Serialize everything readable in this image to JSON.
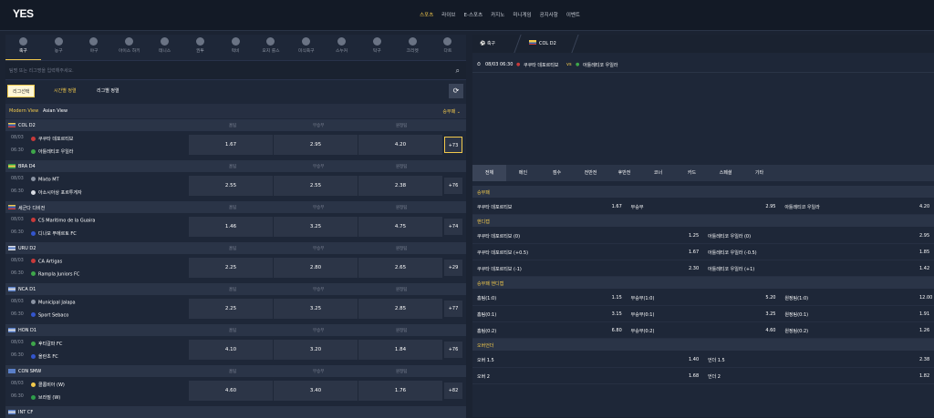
{
  "header": {
    "logo": "YES",
    "nav": [
      {
        "label": "스포츠",
        "active": true
      },
      {
        "label": "라이브"
      },
      {
        "label": "E-스포츠"
      },
      {
        "label": "카지노"
      },
      {
        "label": "미니게임"
      },
      {
        "label": "공지사항"
      },
      {
        "label": "이벤트"
      }
    ]
  },
  "sports": [
    {
      "label": "축구",
      "icon": "soccer-icon",
      "active": true
    },
    {
      "label": "농구",
      "icon": "basketball-icon"
    },
    {
      "label": "야구",
      "icon": "baseball-icon"
    },
    {
      "label": "아이스 하키",
      "icon": "hockey-icon"
    },
    {
      "label": "테니스",
      "icon": "tennis-icon"
    },
    {
      "label": "권투",
      "icon": "boxing-icon"
    },
    {
      "label": "럭비",
      "icon": "rugby-icon"
    },
    {
      "label": "오지 룰스",
      "icon": "aussie-rules-icon"
    },
    {
      "label": "미식축구",
      "icon": "american-football-icon"
    },
    {
      "label": "스누커",
      "icon": "snooker-icon"
    },
    {
      "label": "탁구",
      "icon": "table-tennis-icon"
    },
    {
      "label": "크리켓",
      "icon": "cricket-icon"
    },
    {
      "label": "다트",
      "icon": "darts-icon"
    }
  ],
  "search": {
    "placeholder": "팀명 또는 리그명을 입력해주세요."
  },
  "filters": {
    "league_select": "리그선택",
    "time_sort": "시간별 정렬",
    "league_sort": "리그별 정렬"
  },
  "views": {
    "modern": "Modern View",
    "asian": "Asian View",
    "market": "승무패"
  },
  "odds_headers": {
    "home": "홈팀",
    "draw": "무승부",
    "away": "원정팀"
  },
  "leagues": [
    {
      "name": "COL D2",
      "flag_colors": [
        "#f2c94c",
        "#2d5fb5",
        "#c83a3a"
      ],
      "match": {
        "date": "08/03",
        "time": "06:30",
        "home": "쿠쿠타 데포르티보",
        "away": "아틀레티코 우일라",
        "home_color": "#c83a3a",
        "away_color": "#3ea64a",
        "odds": [
          "1.67",
          "2.95",
          "4.20"
        ],
        "more": "+73",
        "highlight": true
      }
    },
    {
      "name": "BRA D4",
      "flag_colors": [
        "#2e9e4a",
        "#f2c94c",
        "#2e9e4a"
      ],
      "match": {
        "date": "08/03",
        "time": "06:30",
        "home": "Mixto MT",
        "away": "아소시아상 포르투게자",
        "home_color": "#8a93a3",
        "away_color": "#d8dbe2",
        "odds": [
          "2.55",
          "2.55",
          "2.38"
        ],
        "more": "+76"
      }
    },
    {
      "name": "세군다 디비전",
      "flag_colors": [
        "#f2c94c",
        "#2d5fb5",
        "#c83a3a"
      ],
      "match": {
        "date": "08/03",
        "time": "06:30",
        "home": "CS Maritimo de la Guaira",
        "away": "디나모 푸에르토 FC",
        "home_color": "#c83a3a",
        "away_color": "#3355cc",
        "odds": [
          "1.46",
          "3.25",
          "4.75"
        ],
        "more": "+74"
      }
    },
    {
      "name": "URU D2",
      "flag_colors": [
        "#d8dbe2",
        "#5a7fc8",
        "#d8dbe2"
      ],
      "match": {
        "date": "08/03",
        "time": "06:30",
        "home": "CA Artigas",
        "away": "Rampla Juniors FC",
        "home_color": "#c83a3a",
        "away_color": "#3ea64a",
        "odds": [
          "2.25",
          "2.80",
          "2.65"
        ],
        "more": "+29"
      }
    },
    {
      "name": "NCA D1",
      "flag_colors": [
        "#5a7fc8",
        "#d8dbe2",
        "#5a7fc8"
      ],
      "match": {
        "date": "08/03",
        "time": "06:30",
        "home": "Municipal Jalapa",
        "away": "Sport Sebaco",
        "home_color": "#8a93a3",
        "away_color": "#3355cc",
        "odds": [
          "2.25",
          "3.25",
          "2.85"
        ],
        "more": "+77"
      }
    },
    {
      "name": "HON D1",
      "flag_colors": [
        "#5a7fc8",
        "#d8dbe2",
        "#5a7fc8"
      ],
      "match": {
        "date": "08/03",
        "time": "06:30",
        "home": "후티갈파 FC",
        "away": "올란초 FC",
        "home_color": "#3ea64a",
        "away_color": "#3355cc",
        "odds": [
          "4.10",
          "3.20",
          "1.84"
        ],
        "more": "+76"
      }
    },
    {
      "name": "CON SMW",
      "flag_colors": [
        "#5a7fc8",
        "#5a7fc8",
        "#5a7fc8"
      ],
      "match": {
        "date": "08/03",
        "time": "06:30",
        "home": "콜롬비아 (W)",
        "away": "브라질 (W)",
        "home_color": "#f2c94c",
        "away_color": "#2e9e4a",
        "odds": [
          "4.60",
          "3.40",
          "1.76"
        ],
        "more": "+82"
      }
    },
    {
      "name": "INT CF",
      "flag_colors": [
        "#5a7fc8",
        "#d8dbe2",
        "#5a7fc8"
      ]
    }
  ],
  "detail": {
    "tab_sport": "축구",
    "tab_league": "COL D2",
    "match_time": "08/03 06:30",
    "home": "쿠쿠타 데포르티보",
    "vs": "vs",
    "away": "아틀레티코 우일라",
    "market_tabs": [
      "전체",
      "메인",
      "점수",
      "전반전",
      "후반전",
      "코너",
      "카드",
      "스페셜",
      "기타"
    ],
    "sections": [
      {
        "title": "승무패",
        "rows": [
          [
            {
              "label": "쿠쿠타 데포르티보",
              "odd": "1.67"
            },
            {
              "label": "무승부",
              "odd": "2.95"
            },
            {
              "label": "아틀레티코 우일라",
              "odd": "4.20"
            }
          ]
        ]
      },
      {
        "title": "핸디캡",
        "rows": [
          [
            {
              "label": "쿠쿠타 데포르티보 (0)",
              "odd": "1.25"
            },
            {
              "label": "아틀레티코 우일라 (0)",
              "odd": "2.95"
            }
          ],
          [
            {
              "label": "쿠쿠타 데포르티보 (+0.5)",
              "odd": "1.67"
            },
            {
              "label": "아틀레티코 우일라 (-0.5)",
              "odd": "1.85"
            }
          ],
          [
            {
              "label": "쿠쿠타 데포르티보 (-1)",
              "odd": "2.30"
            },
            {
              "label": "아틀레티코 우일라 (+1)",
              "odd": "1.42"
            }
          ]
        ]
      },
      {
        "title": "승무패 핸디캡",
        "rows": [
          [
            {
              "label": "홈팀(1:0)",
              "odd": "1.15"
            },
            {
              "label": "무승부(1:0)",
              "odd": "5.20"
            },
            {
              "label": "원정팀(1:0)",
              "odd": "12.00"
            }
          ],
          [
            {
              "label": "홈팀(0:1)",
              "odd": "3.15"
            },
            {
              "label": "무승부(0:1)",
              "odd": "3.25"
            },
            {
              "label": "원정팀(0:1)",
              "odd": "1.91"
            }
          ],
          [
            {
              "label": "홈팀(0:2)",
              "odd": "6.80"
            },
            {
              "label": "무승부(0:2)",
              "odd": "4.60"
            },
            {
              "label": "원정팀(0:2)",
              "odd": "1.26"
            }
          ]
        ]
      },
      {
        "title": "오버언더",
        "rows": [
          [
            {
              "label": "오버 1.5",
              "odd": "1.40"
            },
            {
              "label": "언더 1.5",
              "odd": "2.38"
            }
          ],
          [
            {
              "label": "오버 2",
              "odd": "1.68"
            },
            {
              "label": "언더 2",
              "odd": "1.82"
            }
          ]
        ]
      }
    ]
  }
}
